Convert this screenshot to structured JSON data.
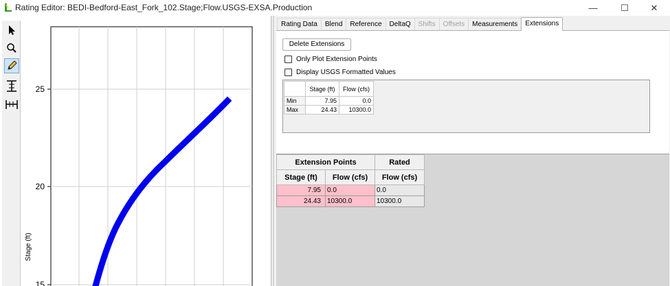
{
  "window": {
    "title": "Rating Editor: BEDI-Bedford-East_Fork_102.Stage;Flow.USGS-EXSA.Production",
    "minimize_glyph": "—",
    "maximize_glyph": "☐",
    "close_glyph": "✕"
  },
  "toolbar": {
    "tools": [
      "pointer-tool",
      "zoom-tool",
      "pencil-tool",
      "stage-line-tool",
      "flow-line-tool"
    ],
    "active": "pencil-tool"
  },
  "plot": {
    "ylabel": "Stage (ft)",
    "y_ticks": [
      "25",
      "20",
      "15"
    ],
    "accent_color": "#0000ee"
  },
  "tabs": [
    {
      "label": "Rating Data",
      "enabled": true
    },
    {
      "label": "Blend",
      "enabled": true
    },
    {
      "label": "Reference",
      "enabled": true
    },
    {
      "label": "DeltaQ",
      "enabled": true
    },
    {
      "label": "Shifts",
      "enabled": false
    },
    {
      "label": "Offsets",
      "enabled": false
    },
    {
      "label": "Measurements",
      "enabled": true
    },
    {
      "label": "Extensions",
      "enabled": true,
      "selected": true
    }
  ],
  "extensions": {
    "delete_button": "Delete Extensions",
    "only_plot_label": "Only Plot Extension Points",
    "display_usgs_label": "Display USGS Formatted Values",
    "stats": {
      "headers": [
        "Stage (ft)",
        "Flow (cfs)"
      ],
      "rows": [
        {
          "label": "Min",
          "stage": "7.95",
          "flow": "0.0"
        },
        {
          "label": "Max",
          "stage": "24.43",
          "flow": "10300.0"
        }
      ]
    },
    "table": {
      "group_headers": [
        "Extension Points",
        "Rated"
      ],
      "col_headers": [
        "Stage (ft)",
        "Flow (cfs)",
        "Flow (cfs)"
      ],
      "rows": [
        {
          "stage": "7.95",
          "flow": "0.0",
          "rated": "0.0"
        },
        {
          "stage": "24.43",
          "flow": "10300.0",
          "rated": "10300.0"
        }
      ],
      "highlight_color": "#ffc0cb"
    }
  }
}
